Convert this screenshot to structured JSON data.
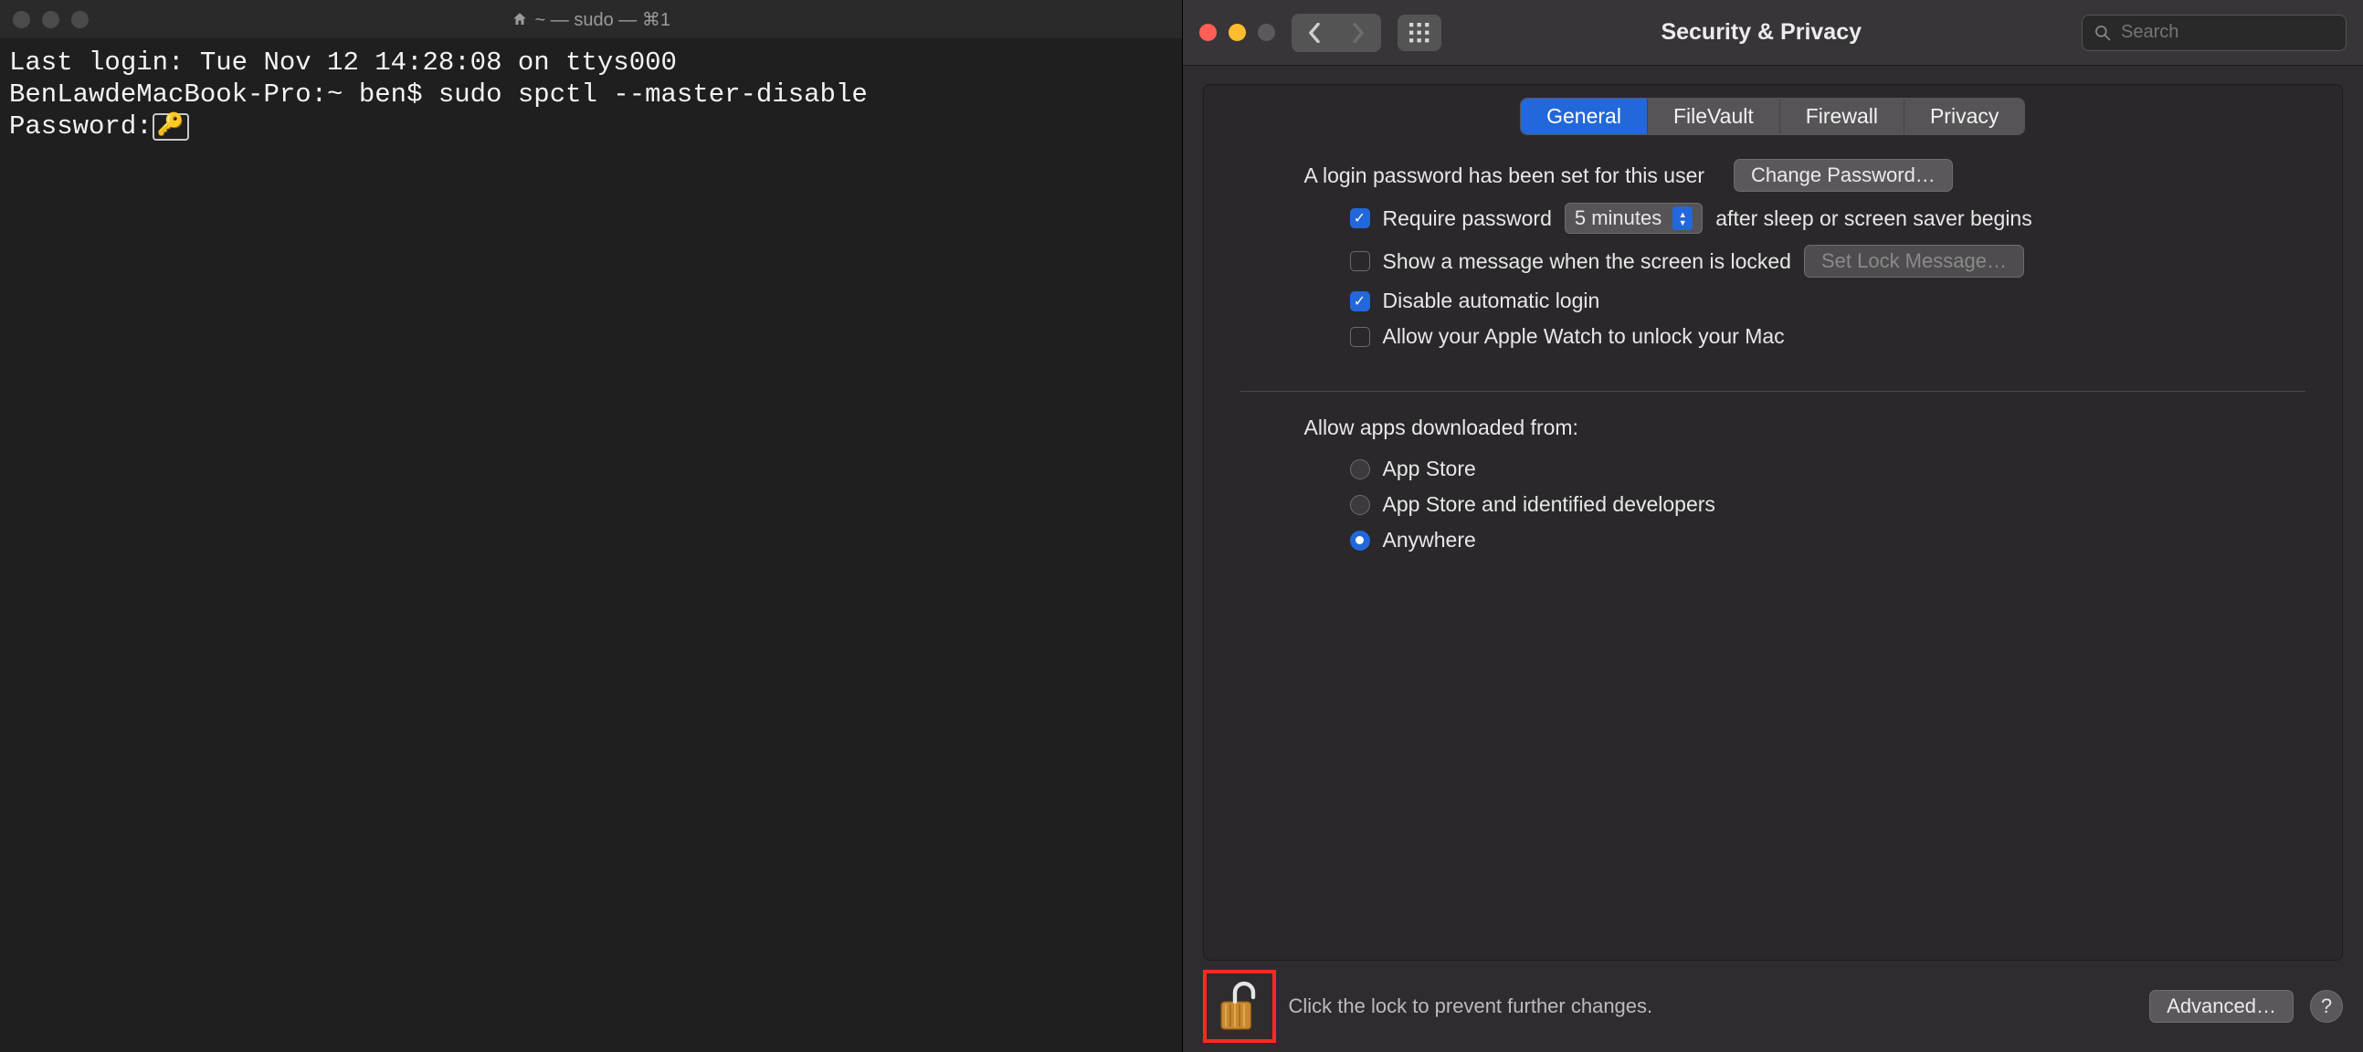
{
  "terminal": {
    "title": "~ — sudo — ⌘1",
    "line1": "Last login: Tue Nov 12 14:28:08 on ttys000",
    "line2": "BenLawdeMacBook-Pro:~ ben$ sudo spctl --master-disable",
    "line3_label": "Password:"
  },
  "prefs": {
    "window_title": "Security & Privacy",
    "search_placeholder": "Search",
    "tabs": {
      "general": "General",
      "filevault": "FileVault",
      "firewall": "Firewall",
      "privacy": "Privacy"
    },
    "login_password_text": "A login password has been set for this user",
    "change_password_btn": "Change Password…",
    "require_password_label": "Require password",
    "require_password_delay": "5 minutes",
    "require_password_suffix": "after sleep or screen saver begins",
    "show_message_label": "Show a message when the screen is locked",
    "set_lock_message_btn": "Set Lock Message…",
    "disable_auto_login_label": "Disable automatic login",
    "apple_watch_label": "Allow your Apple Watch to unlock your Mac",
    "allow_apps_heading": "Allow apps downloaded from:",
    "radio_app_store": "App Store",
    "radio_identified": "App Store and identified developers",
    "radio_anywhere": "Anywhere",
    "lock_hint": "Click the lock to prevent further changes.",
    "advanced_btn": "Advanced…",
    "help_symbol": "?"
  }
}
